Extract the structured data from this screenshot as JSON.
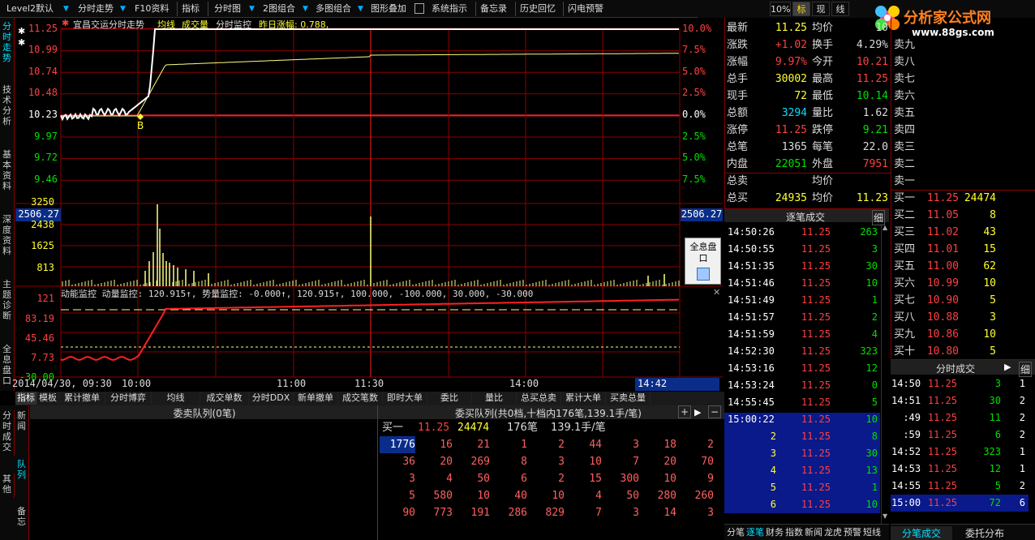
{
  "toolbar": {
    "items": [
      "Level2默认",
      "分时走势",
      "F10资料",
      "指标",
      "分时图",
      "2图组合",
      "多图组合",
      "图形叠加",
      "系统指示",
      "备忘录",
      "历史回忆",
      "闪电预警"
    ],
    "right_buttons": [
      "10%",
      "标",
      "现",
      "线"
    ]
  },
  "logo": {
    "title": "分析家公式网",
    "url": "www.88gs.com"
  },
  "left_tabs": [
    "分时走势",
    "技术分析",
    "基本资料",
    "深度资料",
    "主题诊断",
    "全息盘口"
  ],
  "left_tabs2": [
    "分时成交",
    "新闻",
    "队列",
    "其他",
    "备忘"
  ],
  "chart": {
    "title": "宜昌交运分时走势",
    "ma_label": "均线",
    "vol_label": "成交量",
    "monitor": "分时监控",
    "yest_change": "昨日涨幅: 0.788,",
    "price_ticks": [
      "11.25",
      "10.99",
      "10.74",
      "10.48",
      "10.23",
      "9.97",
      "9.72",
      "9.46"
    ],
    "pct_ticks": [
      "10.0%",
      "7.5%",
      "5.0%",
      "2.5%",
      "0.0%",
      "2.5%",
      "5.0%",
      "7.5%"
    ],
    "vol_ticks": [
      "3250",
      "2438",
      "1625",
      "813"
    ],
    "crosshair_value": "2506.27",
    "marker": "B",
    "indicator_line": "动能监控  动量监控: 120.915↑, 势量监控: -0.000↑, 120.915↑, 100.000, -100.000, 30.000, -30.000",
    "ind_ticks": [
      "121",
      "83.19",
      "45.46",
      "7.73",
      "-30.00"
    ],
    "date_label": "2014/04/30, 09:30",
    "time_ticks": [
      "10:00",
      "11:00",
      "11:30",
      "14:00"
    ],
    "cursor_time": "14:42",
    "float_btn": "全息盘口"
  },
  "quote": {
    "rows": [
      {
        "l1": "最新",
        "v1": "11.25",
        "l2": "均价",
        "v2": "10"
      },
      {
        "l1": "涨跌",
        "v1": "+1.02",
        "l2": "换手",
        "v2": "4.29%"
      },
      {
        "l1": "涨幅",
        "v1": "9.97%",
        "l2": "今开",
        "v2": "10.21"
      },
      {
        "l1": "总手",
        "v1": "30002",
        "l2": "最高",
        "v2": "11.25"
      },
      {
        "l1": "现手",
        "v1": "72",
        "l2": "最低",
        "v2": "10.14"
      },
      {
        "l1": "总额",
        "v1": "3294",
        "l2": "量比",
        "v2": "1.62"
      },
      {
        "l1": "涨停",
        "v1": "11.25",
        "l2": "跌停",
        "v2": "9.21"
      },
      {
        "l1": "总笔",
        "v1": "1365",
        "l2": "每笔",
        "v2": "22.0"
      },
      {
        "l1": "内盘",
        "v1": "22051",
        "l2": "外盘",
        "v2": "7951"
      },
      {
        "l1": "总卖",
        "v1": "",
        "l2": "均价",
        "v2": ""
      },
      {
        "l1": "总买",
        "v1": "24935",
        "l2": "均价",
        "v2": "11.23"
      }
    ],
    "sell_labels": [
      "卖九",
      "卖八",
      "卖七",
      "卖六",
      "卖五",
      "卖四",
      "卖三",
      "卖二",
      "卖一"
    ],
    "buy_rows": [
      {
        "label": "买一",
        "price": "11.25",
        "vol": "24474"
      },
      {
        "label": "买二",
        "price": "11.05",
        "vol": "8"
      },
      {
        "label": "买三",
        "price": "11.02",
        "vol": "43"
      },
      {
        "label": "买四",
        "price": "11.01",
        "vol": "15"
      },
      {
        "label": "买五",
        "price": "11.00",
        "vol": "62"
      },
      {
        "label": "买六",
        "price": "10.99",
        "vol": "10"
      },
      {
        "label": "买七",
        "price": "10.90",
        "vol": "5"
      },
      {
        "label": "买八",
        "price": "10.88",
        "vol": "3"
      },
      {
        "label": "买九",
        "price": "10.86",
        "vol": "10"
      },
      {
        "label": "买十",
        "price": "10.80",
        "vol": "5"
      }
    ]
  },
  "ticks": {
    "header": "逐笔成交",
    "detail_btn": "细",
    "rows": [
      {
        "t": "14:50:26",
        "p": "11.25",
        "v": "263"
      },
      {
        "t": "14:50:55",
        "p": "11.25",
        "v": "3"
      },
      {
        "t": "14:51:35",
        "p": "11.25",
        "v": "30"
      },
      {
        "t": "14:51:46",
        "p": "11.25",
        "v": "10"
      },
      {
        "t": "14:51:49",
        "p": "11.25",
        "v": "1"
      },
      {
        "t": "14:51:57",
        "p": "11.25",
        "v": "2"
      },
      {
        "t": "14:51:59",
        "p": "11.25",
        "v": "4"
      },
      {
        "t": "14:52:30",
        "p": "11.25",
        "v": "323"
      },
      {
        "t": "14:53:16",
        "p": "11.25",
        "v": "12"
      },
      {
        "t": "14:53:24",
        "p": "11.25",
        "v": "0"
      },
      {
        "t": "14:55:45",
        "p": "11.25",
        "v": "5"
      },
      {
        "t": "15:00:22",
        "p": "11.25",
        "v": "10"
      },
      {
        "t": "2",
        "p": "11.25",
        "v": "8"
      },
      {
        "t": "3",
        "p": "11.25",
        "v": "30"
      },
      {
        "t": "4",
        "p": "11.25",
        "v": "13"
      },
      {
        "t": "5",
        "p": "11.25",
        "v": "1"
      },
      {
        "t": "6",
        "p": "11.25",
        "v": "10"
      }
    ],
    "bottom_tabs": [
      "分笔",
      "逐笔",
      "财务",
      "指数",
      "新闻",
      "龙虎",
      "预警",
      "短线"
    ]
  },
  "minute_trades": {
    "header": "分时成交",
    "detail_btn": "细",
    "rows": [
      {
        "t": "14:50",
        "p": "11.25",
        "v": "3",
        "n": "1"
      },
      {
        "t": "14:51",
        "p": "11.25",
        "v": "30",
        "n": "2"
      },
      {
        "t": ":49",
        "p": "11.25",
        "v": "11",
        "n": "2"
      },
      {
        "t": ":59",
        "p": "11.25",
        "v": "6",
        "n": "2"
      },
      {
        "t": "14:52",
        "p": "11.25",
        "v": "323",
        "n": "1"
      },
      {
        "t": "14:53",
        "p": "11.25",
        "v": "12",
        "n": "1"
      },
      {
        "t": "14:55",
        "p": "11.25",
        "v": "5",
        "n": "2"
      },
      {
        "t": "15:00",
        "p": "11.25",
        "v": "72",
        "n": "6"
      }
    ],
    "tabs": [
      "分笔成交",
      "委托分布"
    ]
  },
  "bottom": {
    "tabs": [
      "指标",
      "模板",
      "累计撤单",
      "分时博弈",
      "均线",
      "成交单数",
      "分时DDX",
      "新单撤单",
      "成交笔数",
      "即时大单",
      "委比",
      "量比",
      "总买总卖",
      "累计大单",
      "买卖总量"
    ],
    "sell_queue": "委卖队列(0笔)",
    "buy_queue_title": "委买队列(共0档,十档内176笔,139.1手/笔)",
    "buy_summary": {
      "label": "买一",
      "price": "11.25",
      "vol": "24474",
      "count": "176笔",
      "avg": "139.1手/笔"
    },
    "queue_rows": [
      [
        "1776",
        "16",
        "21",
        "1",
        "2",
        "44",
        "3",
        "18",
        "2"
      ],
      [
        "36",
        "20",
        "269",
        "8",
        "3",
        "10",
        "7",
        "20",
        "70"
      ],
      [
        "3",
        "4",
        "50",
        "6",
        "2",
        "15",
        "300",
        "10",
        "9"
      ],
      [
        "5",
        "580",
        "10",
        "40",
        "10",
        "4",
        "50",
        "280",
        "260"
      ],
      [
        "90",
        "773",
        "191",
        "286",
        "829",
        "7",
        "3",
        "14",
        "3"
      ]
    ]
  },
  "colors": {
    "up": "#ff4040",
    "accent": "#00e0ff",
    "grid": "#8b0000",
    "price_line": "#ffffff",
    "avg_line": "#ffff80"
  }
}
